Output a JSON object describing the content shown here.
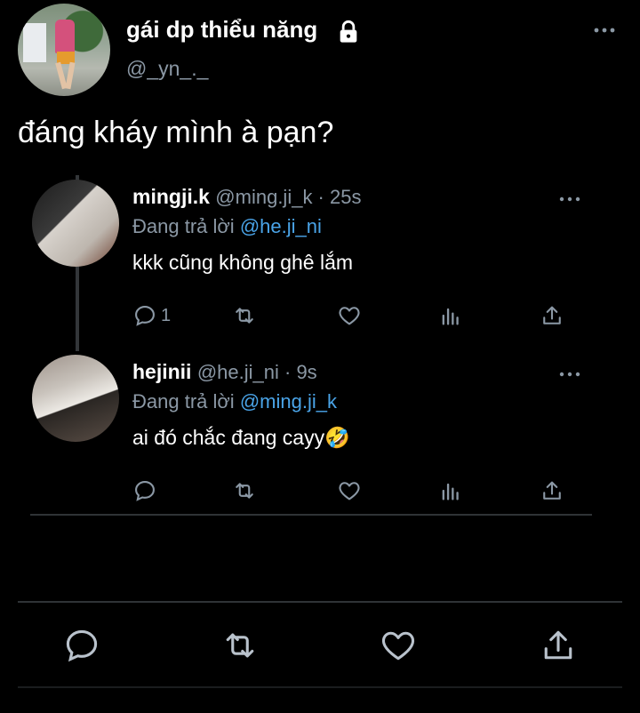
{
  "tweet": {
    "display_name": "gái dp thiểu năng",
    "handle": "@_yn_._",
    "text": "đáng kháy mình à pạn?"
  },
  "replies": [
    {
      "name": "mingji.k",
      "meta": "@ming.ji_k · 25s",
      "replying_prefix": "Đang trả lời",
      "replying_to": "@he.ji_ni",
      "text": "kkk cũng không ghê lắm",
      "reply_count": "1"
    },
    {
      "name": "hejinii",
      "meta": "@he.ji_ni · 9s",
      "replying_prefix": "Đang trả lời",
      "replying_to": "@ming.ji_k",
      "text": "ai đó chắc đang cayy🤣",
      "reply_count": ""
    }
  ],
  "icons": {
    "lock": "lock-icon",
    "more": "more-icon",
    "reply": "reply-icon",
    "retweet": "retweet-icon",
    "like": "heart-icon",
    "views": "views-icon",
    "share": "share-icon"
  },
  "colors": {
    "background": "#000000",
    "text": "#e7e9ea",
    "secondary": "#8b98a5",
    "mention": "#4aa4e8",
    "separator": "#2f3336"
  }
}
